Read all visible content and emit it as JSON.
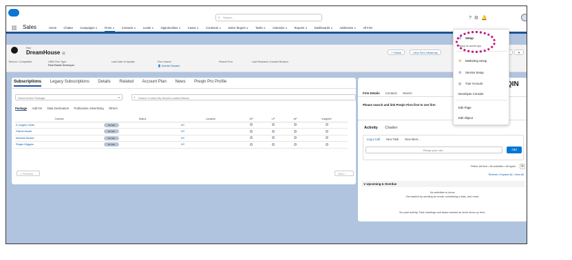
{
  "header": {
    "search_placeholder": "Search...",
    "icons": [
      "help-icon",
      "gear-icon",
      "bell-icon"
    ],
    "app_name": "Sales",
    "nav_items": [
      "Home",
      "Chatter",
      "Campaigns ∨",
      "Firms ∨",
      "Contacts ∨",
      "Leads ∨",
      "Opportunities ∨",
      "Cases ∨",
      "Contracts ∨",
      "Sales Targets ∨",
      "Tasks ∨",
      "Calendar ∨",
      "Reports ∨",
      "Dashboards ∨",
      "Addresses ∨",
      "All Firm"
    ],
    "active_nav": "Firms ∨"
  },
  "record": {
    "object_label": "Firm",
    "name": "DreamHouse",
    "fields": [
      {
        "label": "Tiereno / Competitor",
        "value": ""
      },
      {
        "label": "CBM Firm Type",
        "value": "Real Estate Developer"
      },
      {
        "label": "Last Date of Update",
        "value": ""
      },
      {
        "label": "Firm Owner",
        "value": "Deirdre Desario"
      },
      {
        "label": "Parent Firm",
        "value": ""
      },
      {
        "label": "Last Research Contact Reason",
        "value": ""
      }
    ],
    "follow_label": "+ Follow",
    "hierarchy_label": "View Firm Hierarchy",
    "more_label": "ers",
    "more_caret": "▼"
  },
  "left_tabs": [
    "Subscriptions",
    "Legacy Subscriptions",
    "Details",
    "Related",
    "Account Plan",
    "News",
    "Preqin Pro Profile"
  ],
  "filters": {
    "package_placeholder": "Select Active Package",
    "contact_search_placeholder": "Search Contact By Name/Location/Status"
  },
  "sub_tabs": [
    "Package",
    "Add-On",
    "Data Destination",
    "Publication Advertising",
    "Others"
  ],
  "table": {
    "columns": [
      "Contact",
      "Status",
      "Location",
      "GP",
      "LP",
      "AP",
      "Insights+"
    ],
    "rows": [
      {
        "contact": "D' Angelo Smith",
        "status": "No Sub",
        "location": "NY"
      },
      {
        "contact": "Fatima Ansari",
        "status": "No Sub",
        "location": "NY"
      },
      {
        "contact": "Michelle Becker",
        "status": "No Sub",
        "location": "NY"
      },
      {
        "contact": "Regan Wiggins",
        "status": "No Sub",
        "location": "NY"
      }
    ],
    "prev_label": "< Previous",
    "next_label": "Next >"
  },
  "preqin": {
    "logo": "QIN",
    "tabs": [
      "Firm Details",
      "Contacts",
      "Search"
    ],
    "message": "Please search and link Preqin Firm first to see firm"
  },
  "activity": {
    "tabs": [
      "Activity",
      "Chatter"
    ],
    "sub_tabs": [
      "Log a Call",
      "New Task",
      "New Meet..."
    ],
    "call_placeholder": "Recap your call...",
    "add_label": "Add",
    "filters_text": "Filters: All time • All activities • All types",
    "refresh_text": "Refresh • Expand All • View All",
    "upcoming_label": "∨  Upcoming & Overdue",
    "no_activities_line1": "No activities to show.",
    "no_activities_line2": "Get started by sending an email, scheduling a task, and more.",
    "no_past": "No past activity. Past meetings and tasks marked as done show up here."
  },
  "setup_menu": {
    "setup": "Setup",
    "setup_sub": "Setup for current app",
    "marketing_setup": "Marketing Setup",
    "service_setup": "Service Setup",
    "your_account": "Your Account",
    "developer_console": "Developer Console",
    "edit_page": "Edit Page",
    "edit_object": "Edit Object"
  },
  "colors": {
    "brand": "#0b76d3",
    "nav_border": "#1b5297",
    "highlight": "#c2187f",
    "background": "#b0c4df"
  }
}
